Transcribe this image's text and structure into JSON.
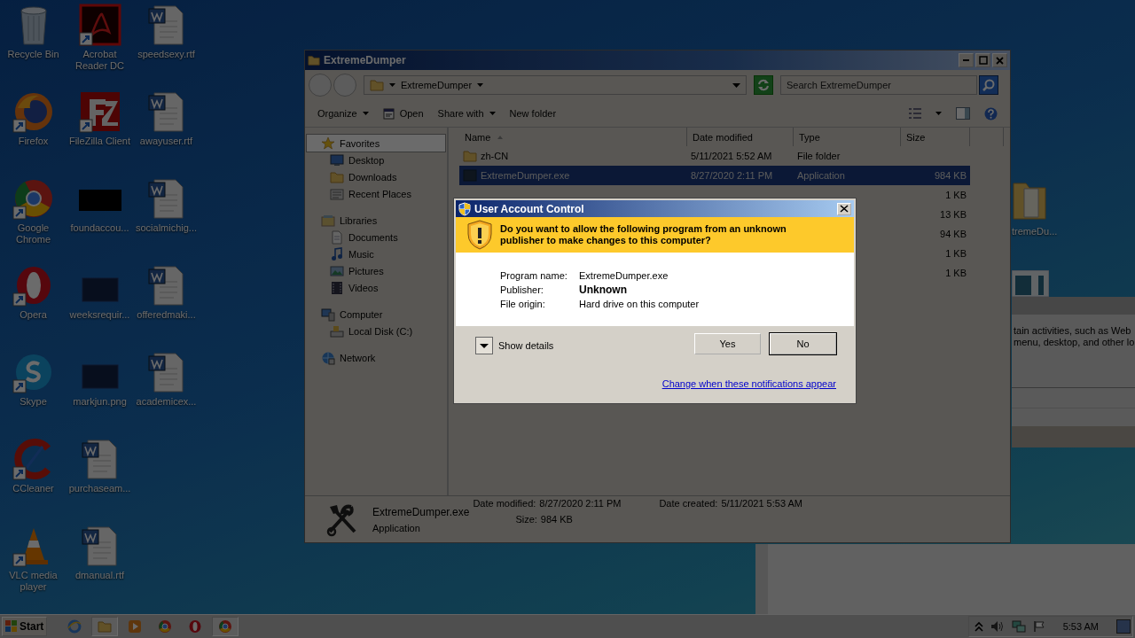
{
  "desktop": {
    "icons": [
      {
        "label": "Recycle Bin",
        "kind": "bin",
        "shortcut": false
      },
      {
        "label": "Firefox",
        "kind": "firefox",
        "shortcut": true
      },
      {
        "label": "Google Chrome",
        "kind": "chrome",
        "shortcut": true
      },
      {
        "label": "Opera",
        "kind": "opera",
        "shortcut": true
      },
      {
        "label": "Skype",
        "kind": "skype",
        "shortcut": true
      },
      {
        "label": "CCleaner",
        "kind": "ccleaner",
        "shortcut": true
      },
      {
        "label": "VLC media player",
        "kind": "vlc",
        "shortcut": true
      },
      {
        "label": "Acrobat Reader DC",
        "kind": "acrobat",
        "shortcut": true
      },
      {
        "label": "FileZilla Client",
        "kind": "filezilla",
        "shortcut": true
      },
      {
        "label": "foundaccou...",
        "kind": "dark-image",
        "shortcut": false
      },
      {
        "label": "weeksrequir...",
        "kind": "image",
        "shortcut": false
      },
      {
        "label": "markjun.png",
        "kind": "image",
        "shortcut": false
      },
      {
        "label": "purchaseam...",
        "kind": "word",
        "shortcut": false
      },
      {
        "label": "dmanual.rtf",
        "kind": "word",
        "shortcut": false
      },
      {
        "label": "speedsexy.rtf",
        "kind": "word",
        "shortcut": false
      },
      {
        "label": "awayuser.rtf",
        "kind": "word",
        "shortcut": false
      },
      {
        "label": "socialmichig...",
        "kind": "word",
        "shortcut": false
      },
      {
        "label": "offeredmaki...",
        "kind": "word",
        "shortcut": false
      },
      {
        "label": "academicex...",
        "kind": "word",
        "shortcut": false
      }
    ],
    "partial_icon": {
      "label": "tremeDu..."
    }
  },
  "background_window": {
    "lines": [
      "tain activities, such as Web",
      "menu, desktop, and other lo"
    ]
  },
  "explorer": {
    "title": "ExtremeDumper",
    "address": "ExtremeDumper",
    "search": {
      "placeholder": "Search ExtremeDumper"
    },
    "toolbar": [
      {
        "label": "Organize",
        "kind": "menu"
      },
      {
        "label": "Open",
        "kind": "open"
      },
      {
        "label": "Share with",
        "kind": "menu"
      },
      {
        "label": "New folder",
        "kind": "plain"
      }
    ],
    "navigation": [
      {
        "label": "Favorites",
        "kind": "star",
        "selected": true,
        "children": [
          {
            "label": "Desktop",
            "kind": "desktop",
            "selected": false
          },
          {
            "label": "Downloads",
            "kind": "folder",
            "selected": false
          },
          {
            "label": "Recent Places",
            "kind": "recent",
            "selected": false
          }
        ]
      },
      {
        "label": "Libraries",
        "kind": "library",
        "selected": false,
        "children": [
          {
            "label": "Documents",
            "kind": "document",
            "selected": false
          },
          {
            "label": "Music",
            "kind": "music",
            "selected": false
          },
          {
            "label": "Pictures",
            "kind": "pictures",
            "selected": false
          },
          {
            "label": "Videos",
            "kind": "videos",
            "selected": false
          }
        ]
      },
      {
        "label": "Computer",
        "kind": "computer",
        "selected": false,
        "children": [
          {
            "label": "Local Disk (C:)",
            "kind": "disk",
            "selected": false
          }
        ]
      },
      {
        "label": "Network",
        "kind": "network",
        "selected": false
      }
    ],
    "columns": [
      "Name",
      "Date modified",
      "Type",
      "Size"
    ],
    "rows": [
      {
        "name": "zh-CN",
        "kind": "folder",
        "date": "5/11/2021 5:52 AM",
        "type": "File folder",
        "selected": false
      },
      {
        "name": "ExtremeDumper.exe",
        "kind": "exe",
        "date": "8/27/2020 2:11 PM",
        "type": "Application",
        "size": "984 KB",
        "selected": true
      },
      {
        "size": "1 KB",
        "selected": false
      },
      {
        "size": "13 KB",
        "selected": false
      },
      {
        "size": "94 KB",
        "selected": false
      },
      {
        "size": "1 KB",
        "selected": false
      },
      {
        "size": "1 KB",
        "selected": false
      }
    ],
    "details": {
      "name": "ExtremeDumper.exe",
      "type": "Application",
      "fields": [
        {
          "label": "Date modified:",
          "value": "8/27/2020 2:11 PM"
        },
        {
          "label": "Size:",
          "value": "984 KB"
        },
        {
          "label": "Date created:",
          "value": "5/11/2021 5:53 AM"
        }
      ]
    }
  },
  "uac": {
    "title": "User Account Control",
    "question": "Do you want to allow the following program from an unknown publisher to make changes to this computer?",
    "fields": [
      {
        "label": "Program name:",
        "value": "ExtremeDumper.exe",
        "bold": false
      },
      {
        "label": "Publisher:",
        "value": "Unknown",
        "bold": true
      },
      {
        "label": "File origin:",
        "value": "Hard drive on this computer",
        "bold": false
      }
    ],
    "details_toggle": {
      "label": "Show details",
      "expanded": false
    },
    "buttons": [
      {
        "label": "Yes",
        "default": false
      },
      {
        "label": "No",
        "default": true
      }
    ],
    "link": "Change when these notifications appear"
  },
  "taskbar": {
    "start": "Start",
    "apps": [
      {
        "kind": "ie",
        "running": false
      },
      {
        "kind": "explorer",
        "running": true
      },
      {
        "kind": "media",
        "running": false
      },
      {
        "kind": "chrome",
        "running": false
      },
      {
        "kind": "opera",
        "running": false
      },
      {
        "kind": "chrome",
        "running": true
      }
    ],
    "clock": "5:53 AM"
  }
}
